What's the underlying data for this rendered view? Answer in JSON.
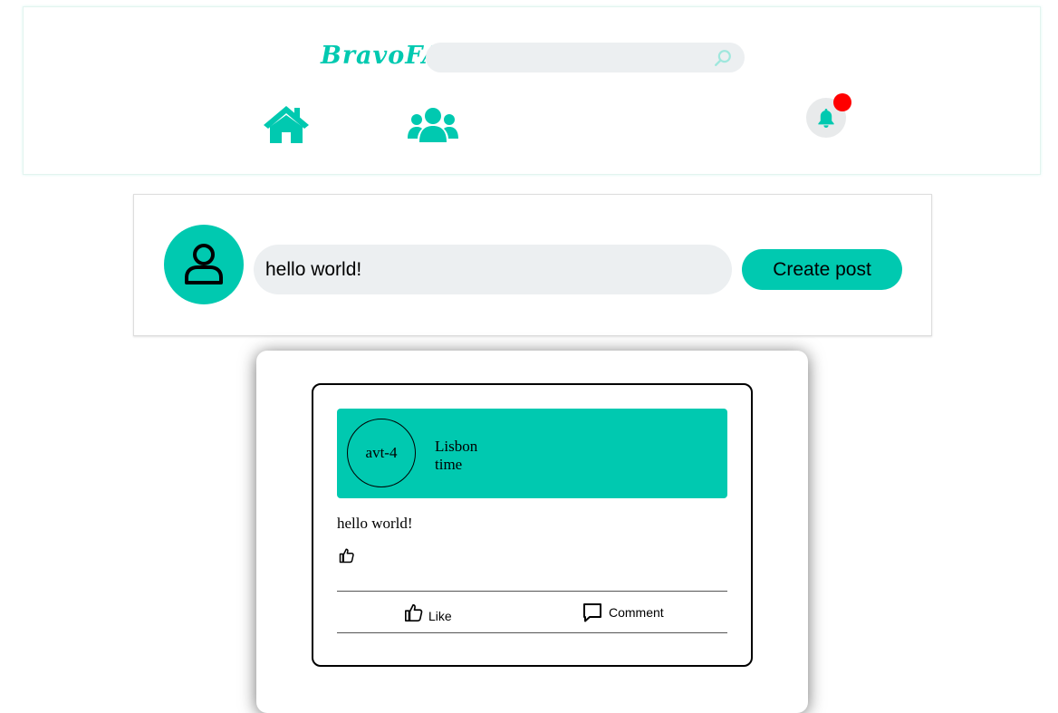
{
  "header": {
    "logo": "BravoFA",
    "search": {
      "value": "",
      "placeholder": ""
    },
    "notification_badge_color": "#ff0000"
  },
  "composer": {
    "input_value": "hello world!",
    "create_button_label": "Create post"
  },
  "post": {
    "avatar_text": "avt-4",
    "location": "Lisbon",
    "time": "time",
    "text": "hello world!",
    "like_label": "Like",
    "comment_label": "Comment"
  },
  "colors": {
    "accent": "#00c9b0",
    "input_background": "#eceff1",
    "notification": "#ff0000"
  },
  "icons": {
    "nav": [
      "home-icon",
      "users-icon",
      "bell-icon"
    ],
    "search": "search-icon",
    "composer_avatar": "user-icon",
    "post_actions": [
      "thumbs-up-icon",
      "comment-icon"
    ]
  }
}
